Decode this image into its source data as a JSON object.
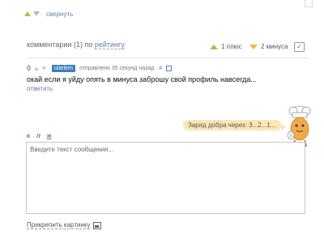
{
  "top": {
    "collapse_label": "свернуть"
  },
  "comments": {
    "header_label": "комментарии (1) по",
    "sort_label": "рейтингу",
    "plus_label": "1 плюс",
    "minus_label": "2 минуса"
  },
  "comment": {
    "score": "0",
    "username": "ularlem",
    "time": "отправлено 35 секунд назад",
    "text": "окай если я уйду опять в минуса заброшу свой профиль навсегда...",
    "reply_label": "ответить"
  },
  "karma": {
    "text": "Заряд добра через: 3...2...1..."
  },
  "format_bar": {
    "bold": "к",
    "italic": "п",
    "underline": "ж"
  },
  "editor": {
    "placeholder": "Введите текст сообщения..."
  },
  "attach": {
    "label": "Прикрепить картинку"
  },
  "colors": {
    "accent_green": "#a4c638",
    "accent_orange": "#f0b43c",
    "link_blue": "#5f7fa6",
    "badge_blue": "#3d7eb8"
  },
  "icons": [
    "thumb-up-icon",
    "thumb-down-icon",
    "checkmark-icon",
    "permalink-icon",
    "image-icon",
    "chef-mascot-icon"
  ]
}
